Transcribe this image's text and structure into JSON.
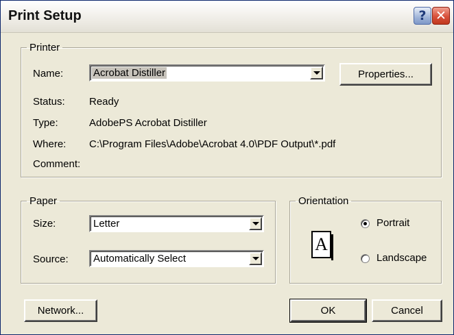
{
  "window": {
    "title": "Print Setup",
    "help_glyph": "?",
    "close_glyph": "✕"
  },
  "printer": {
    "legend": "Printer",
    "name_label": "Name:",
    "name_value": "Acrobat Distiller",
    "properties_button": "Properties...",
    "status_label": "Status:",
    "status_value": "Ready",
    "type_label": "Type:",
    "type_value": "AdobePS Acrobat Distiller",
    "where_label": "Where:",
    "where_value": "C:\\Program Files\\Adobe\\Acrobat 4.0\\PDF Output\\*.pdf",
    "comment_label": "Comment:",
    "comment_value": ""
  },
  "paper": {
    "legend": "Paper",
    "size_label": "Size:",
    "size_value": "Letter",
    "source_label": "Source:",
    "source_value": "Automatically Select"
  },
  "orientation": {
    "legend": "Orientation",
    "page_glyph": "A",
    "portrait_label": "Portrait",
    "landscape_label": "Landscape",
    "selected": "Portrait"
  },
  "buttons": {
    "network": "Network...",
    "ok": "OK",
    "cancel": "Cancel"
  },
  "colors": {
    "dialog_bg": "#ece9d8",
    "selection_bg": "#c7c3bb",
    "close_red": "#d8503a",
    "help_blue": "#9fb4d8"
  }
}
